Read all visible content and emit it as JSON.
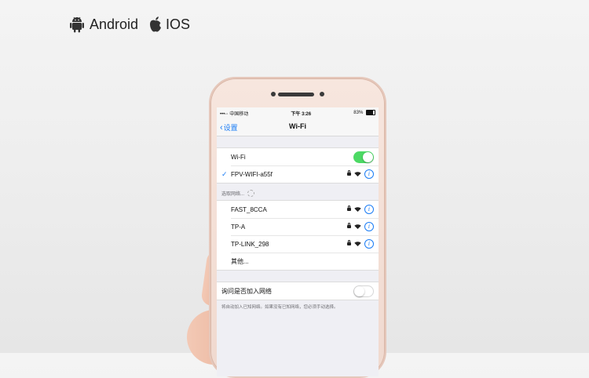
{
  "os": {
    "android_label": "Android",
    "ios_label": "IOS",
    "icons": [
      "android-robot-icon",
      "apple-icon"
    ]
  },
  "status_bar": {
    "carrier": "•••◦◦ 中国移动",
    "time": "下午 3:26",
    "battery": "83%"
  },
  "nav": {
    "back_label": "设置",
    "title": "Wi-Fi"
  },
  "wifi": {
    "toggle_label": "Wi-Fi",
    "enabled": true,
    "connected_network": "FPV-WIFI-a55f"
  },
  "choose_network_label": "选取网络...",
  "networks": [
    {
      "name": "FAST_8CCA"
    },
    {
      "name": "TP-A"
    },
    {
      "name": "TP-LINK_298"
    }
  ],
  "other_label": "其他...",
  "ask_to_join": {
    "label": "询问是否加入网络",
    "enabled": false,
    "footnote": "将自动加入已知网络。如果没有已知网络，您必须手动选择。"
  },
  "colors": {
    "accent": "#1a7cf5",
    "toggle_on": "#4cd964"
  }
}
